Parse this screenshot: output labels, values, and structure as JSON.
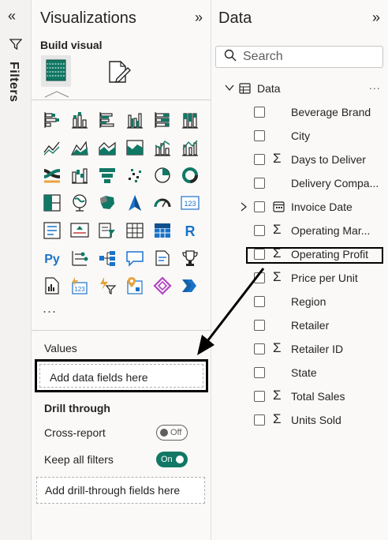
{
  "filters": {
    "label": "Filters",
    "collapse_icon": "double-chevron-left-icon"
  },
  "visualizations": {
    "title": "Visualizations",
    "build_visual_label": "Build visual",
    "more": "...",
    "values_label": "Values",
    "values_placeholder": "Add data fields here",
    "drill_through_label": "Drill through",
    "cross_report_label": "Cross-report",
    "cross_report_state": "Off",
    "keep_filters_label": "Keep all filters",
    "keep_filters_state": "On",
    "drill_placeholder": "Add drill-through fields here",
    "accent_color": "#117865"
  },
  "data": {
    "title": "Data",
    "search_placeholder": "Search",
    "table_name": "Data",
    "more": "...",
    "fields": [
      {
        "name": "Beverage Brand",
        "sigma": false
      },
      {
        "name": "City",
        "sigma": false
      },
      {
        "name": "Days to Deliver",
        "sigma": true
      },
      {
        "name": "Delivery Compa...",
        "sigma": false
      },
      {
        "name": "Invoice Date",
        "sigma": false,
        "calendar": true,
        "expandable": true
      },
      {
        "name": "Operating Mar...",
        "sigma": true
      },
      {
        "name": "Operating Profit",
        "sigma": true,
        "highlighted": true
      },
      {
        "name": "Price per Unit",
        "sigma": true
      },
      {
        "name": "Region",
        "sigma": false
      },
      {
        "name": "Retailer",
        "sigma": false
      },
      {
        "name": "Retailer ID",
        "sigma": true
      },
      {
        "name": "State",
        "sigma": false
      },
      {
        "name": "Total Sales",
        "sigma": true
      },
      {
        "name": "Units Sold",
        "sigma": true
      }
    ]
  }
}
